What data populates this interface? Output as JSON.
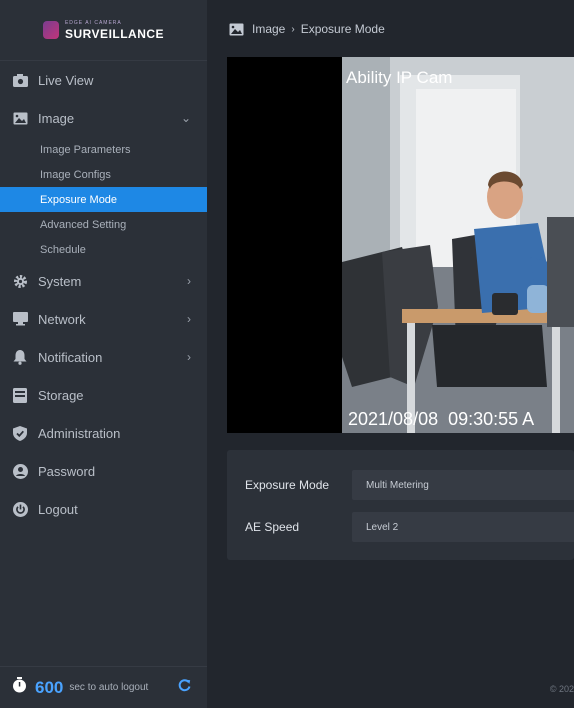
{
  "brand": {
    "small": "Edge AI Camera",
    "big": "SURVEILLANCE"
  },
  "sidebar": {
    "items": [
      {
        "label": "Live View",
        "icon": "camera-icon"
      },
      {
        "label": "Image",
        "icon": "image-icon",
        "expanded": true
      },
      {
        "label": "System",
        "icon": "gear-icon"
      },
      {
        "label": "Network",
        "icon": "monitor-icon"
      },
      {
        "label": "Notification",
        "icon": "bell-icon"
      },
      {
        "label": "Storage",
        "icon": "storage-icon"
      },
      {
        "label": "Administration",
        "icon": "shield-icon"
      },
      {
        "label": "Password",
        "icon": "user-icon"
      },
      {
        "label": "Logout",
        "icon": "power-icon"
      }
    ],
    "image_sub": [
      "Image Parameters",
      "Image Configs",
      "Exposure Mode",
      "Advanced Setting",
      "Schedule"
    ],
    "active_sub": "Exposure Mode"
  },
  "footer": {
    "count": "600",
    "text": "sec to auto logout"
  },
  "breadcrumb": {
    "parent": "Image",
    "current": "Exposure Mode"
  },
  "camera": {
    "overlay_title": "Ability IP Cam",
    "timestamp": "2021/08/08  09:30:55 A"
  },
  "form": {
    "exposure_label": "Exposure Mode",
    "exposure_value": "Multi Metering",
    "ae_label": "AE Speed",
    "ae_value": "Level 2"
  },
  "copyright": "© 202",
  "colors": {
    "accent": "#1e88e5",
    "sidebar": "#2b3038",
    "background": "#22262d"
  }
}
